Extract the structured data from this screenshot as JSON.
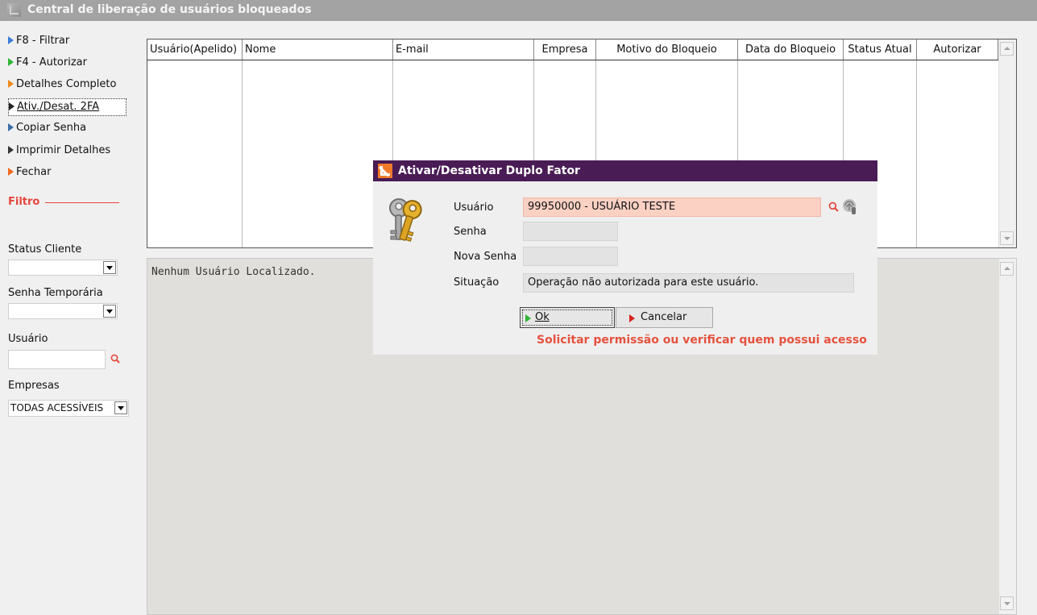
{
  "window": {
    "title": "Central de liberação de usuários bloqueados"
  },
  "sidebar": {
    "buttons": [
      {
        "label": "F8 - Filtrar",
        "color": "#3c7ad6"
      },
      {
        "label": "F4 - Autorizar",
        "color": "#2fb535"
      },
      {
        "label": "Detalhes Completo",
        "color": "#f08a1c"
      },
      {
        "label": "Ativ./Desat. 2FA",
        "color": "#222222"
      },
      {
        "label": "Copiar Senha",
        "color": "#3c6fa8"
      },
      {
        "label": "Imprimir Detalhes",
        "color": "#333333"
      },
      {
        "label": "Fechar",
        "color": "#f06a1c"
      }
    ],
    "filter_title": "Filtro",
    "status_cliente_label": "Status Cliente",
    "status_cliente_value": "",
    "senha_temporaria_label": "Senha Temporária",
    "senha_temporaria_value": "",
    "usuario_label": "Usuário",
    "usuario_value": "",
    "empresas_label": "Empresas",
    "empresas_value": "TODAS ACESSÍVEIS"
  },
  "grid": {
    "columns": [
      "Usuário(Apelido)",
      "Nome",
      "E-mail",
      "Empresa",
      "Motivo do Bloqueio",
      "Data do Bloqueio",
      "Status Atual",
      "Autorizar"
    ],
    "rows": []
  },
  "memo": {
    "text": "Nenhum Usuário Localizado."
  },
  "dialog": {
    "title": "Ativar/Desativar Duplo Fator",
    "usuario_label": "Usuário",
    "usuario_value": "99950000 - USUÁRIO TESTE",
    "senha_label": "Senha",
    "senha_value": "",
    "nova_senha_label": "Nova Senha",
    "nova_senha_value": "",
    "situacao_label": "Situação",
    "situacao_value": "Operação não autorizada para este usuário.",
    "ok_label": "Ok",
    "cancel_label": "Cancelar",
    "warning": "Solicitar permissão ou verificar quem possui acesso"
  },
  "colors": {
    "dialog_title_bg": "#4a1c55",
    "warning_text": "#e5523e",
    "filter_accent": "#e3463d",
    "user_field_bg": "#fbd1c4"
  }
}
